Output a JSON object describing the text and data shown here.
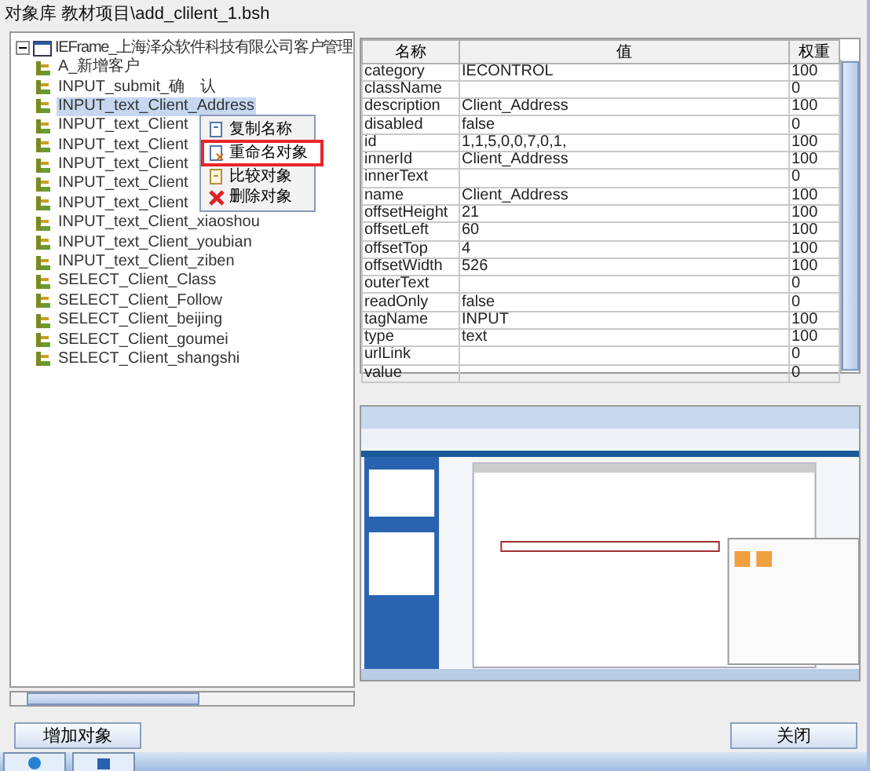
{
  "window": {
    "title": "对象库  教材项目\\add_clilent_1.bsh"
  },
  "tree": {
    "label": "IEFrame_上海泽众软件科技有限公司客户管理",
    "expanded": true,
    "children": [
      {
        "label": "A_新增客户",
        "selected": false
      },
      {
        "label": "INPUT_submit_确　认",
        "selected": false
      },
      {
        "label": "INPUT_text_Client_Address",
        "selected": true
      },
      {
        "label": "INPUT_text_Client",
        "selected": false
      },
      {
        "label": "INPUT_text_Client",
        "selected": false
      },
      {
        "label": "INPUT_text_Client",
        "selected": false
      },
      {
        "label": "INPUT_text_Client",
        "selected": false
      },
      {
        "label": "INPUT_text_Client",
        "selected": false
      },
      {
        "label": "INPUT_text_Client_xiaoshou",
        "selected": false
      },
      {
        "label": "INPUT_text_Client_youbian",
        "selected": false
      },
      {
        "label": "INPUT_text_Client_ziben",
        "selected": false
      },
      {
        "label": "SELECT_Client_Class",
        "selected": false
      },
      {
        "label": "SELECT_Client_Follow",
        "selected": false
      },
      {
        "label": "SELECT_Client_beijing",
        "selected": false
      },
      {
        "label": "SELECT_Client_goumei",
        "selected": false
      },
      {
        "label": "SELECT_Client_shangshi",
        "selected": false
      }
    ]
  },
  "context_menu": [
    {
      "label": "复制名称",
      "kind": "copy",
      "highlighted": false
    },
    {
      "label": "重命名对象",
      "kind": "rename",
      "highlighted": true
    },
    {
      "label": "比较对象",
      "kind": "compare",
      "highlighted": false
    },
    {
      "label": "删除对象",
      "kind": "delete",
      "highlighted": false
    }
  ],
  "table": {
    "columns": [
      "名称",
      "值",
      "权重"
    ],
    "rows": [
      [
        "category",
        "IECONTROL",
        "100"
      ],
      [
        "className",
        "",
        "0"
      ],
      [
        "description",
        "Client_Address",
        "100"
      ],
      [
        "disabled",
        "false",
        "0"
      ],
      [
        "id",
        "1,1,5,0,0,7,0,1,",
        "100"
      ],
      [
        "innerId",
        "Client_Address",
        "100"
      ],
      [
        "innerText",
        "",
        "0"
      ],
      [
        "name",
        "Client_Address",
        "100"
      ],
      [
        "offsetHeight",
        "21",
        "100"
      ],
      [
        "offsetLeft",
        "60",
        "100"
      ],
      [
        "offsetTop",
        "4",
        "100"
      ],
      [
        "offsetWidth",
        "526",
        "100"
      ],
      [
        "outerText",
        "",
        "0"
      ],
      [
        "readOnly",
        "false",
        "0"
      ],
      [
        "tagName",
        "INPUT",
        "100"
      ],
      [
        "type",
        "text",
        "100"
      ],
      [
        "urlLink",
        "",
        "0"
      ],
      [
        "value",
        "",
        "0"
      ]
    ]
  },
  "buttons": {
    "add": "增加对象",
    "close": "关闭"
  }
}
